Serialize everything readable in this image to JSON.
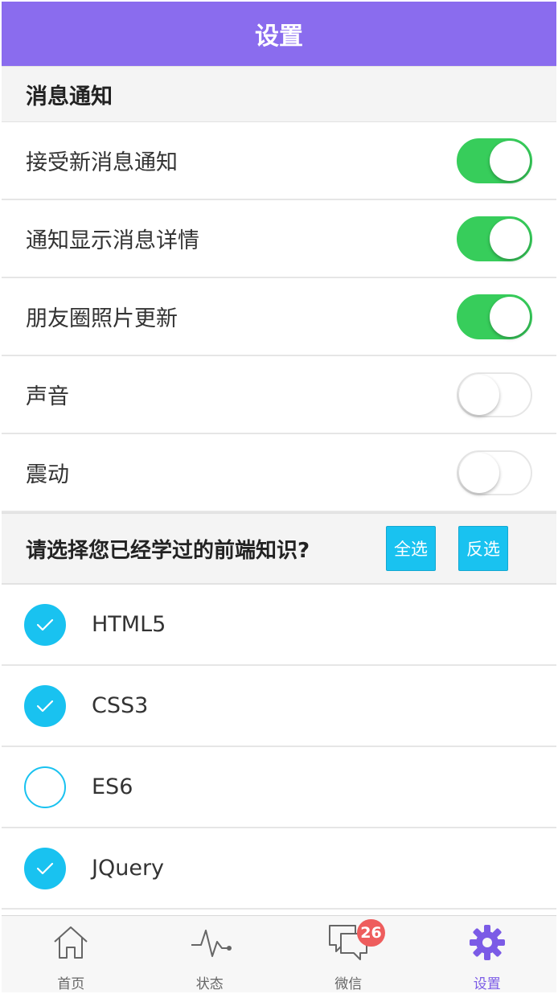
{
  "header": {
    "title": "设置"
  },
  "notifications": {
    "section_title": "消息通知",
    "items": [
      {
        "label": "接受新消息通知",
        "on": true
      },
      {
        "label": "通知显示消息详情",
        "on": true
      },
      {
        "label": "朋友圈照片更新",
        "on": true
      },
      {
        "label": "声音",
        "on": false
      },
      {
        "label": "震动",
        "on": false
      }
    ]
  },
  "quiz": {
    "title": "请选择您已经学过的前端知识?",
    "select_all_label": "全选",
    "invert_label": "反选",
    "options": [
      {
        "label": "HTML5",
        "checked": true
      },
      {
        "label": "CSS3",
        "checked": true
      },
      {
        "label": "ES6",
        "checked": false
      },
      {
        "label": "JQuery",
        "checked": true
      }
    ]
  },
  "tabbar": {
    "tabs": [
      {
        "label": "首页",
        "icon": "home-icon",
        "active": false
      },
      {
        "label": "状态",
        "icon": "pulse-icon",
        "active": false
      },
      {
        "label": "微信",
        "icon": "chat-icon",
        "active": false,
        "badge": "26"
      },
      {
        "label": "设置",
        "icon": "gear-icon",
        "active": true
      }
    ]
  },
  "colors": {
    "nav": "#8a6cee",
    "switch_on": "#37cd5b",
    "accent": "#19c2f0",
    "active_tab": "#7b5be6",
    "badge": "#ee5d5d"
  }
}
